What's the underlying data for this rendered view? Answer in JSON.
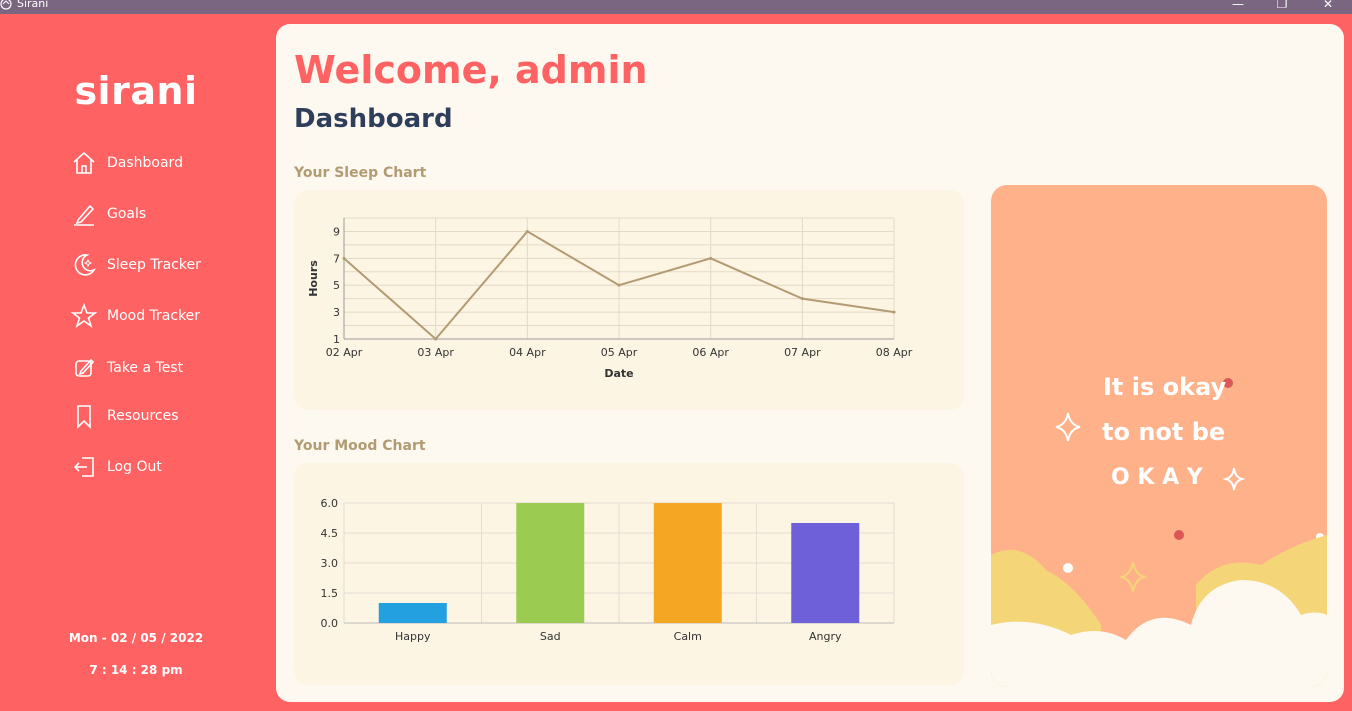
{
  "window": {
    "title": "Sirani",
    "minimize_label": "—",
    "maximize_label": "❐",
    "close_label": "✕"
  },
  "sidebar": {
    "logo": "sirani",
    "items": [
      {
        "label": "Dashboard",
        "icon": "home-icon"
      },
      {
        "label": "Goals",
        "icon": "pencil-icon"
      },
      {
        "label": "Sleep Tracker",
        "icon": "moon-icon"
      },
      {
        "label": "Mood Tracker",
        "icon": "star-icon"
      },
      {
        "label": "Take a Test",
        "icon": "edit-square-icon"
      },
      {
        "label": "Resources",
        "icon": "bookmark-icon"
      },
      {
        "label": "Log Out",
        "icon": "logout-icon"
      }
    ],
    "date": "Mon - 02 / 05 / 2022",
    "time": "7 : 14 : 28 pm"
  },
  "main": {
    "welcome": "Welcome, admin",
    "title": "Dashboard",
    "sleep_section_title": "Your Sleep Chart",
    "mood_section_title": "Your Mood Chart"
  },
  "quote": {
    "line1": "It is okay",
    "line2": "to not be",
    "line3": "O K A Y"
  },
  "colors": {
    "brand": "#ff6262",
    "sidebar_bg": "#ff6262",
    "main_bg": "#fdf9f1",
    "card_bg": "#fdf5e4",
    "sleep_line": "#b29b72",
    "quote_bg": "#ffb18a"
  },
  "chart_data": [
    {
      "type": "line",
      "x": [
        "02 Apr",
        "03 Apr",
        "04 Apr",
        "05 Apr",
        "06 Apr",
        "07 Apr",
        "08 Apr"
      ],
      "series": [
        {
          "values": [
            7,
            1,
            9,
            5,
            7,
            4,
            3
          ]
        }
      ],
      "xlabel": "Date",
      "ylabel": "Hours",
      "ylim": [
        1,
        10
      ],
      "yticks": [
        "1",
        "3",
        "5",
        "7",
        "9"
      ],
      "grid": true
    },
    {
      "type": "bar",
      "categories": [
        "Happy",
        "Sad",
        "Calm",
        "Angry"
      ],
      "values": [
        1,
        6,
        6,
        5
      ],
      "colors": [
        "#22a0e0",
        "#9bcb50",
        "#f5a623",
        "#6e60d8"
      ],
      "ylim": [
        0,
        6
      ],
      "yticks": [
        "0.0",
        "1.5",
        "3.0",
        "4.5",
        "6.0"
      ],
      "grid": true
    }
  ]
}
